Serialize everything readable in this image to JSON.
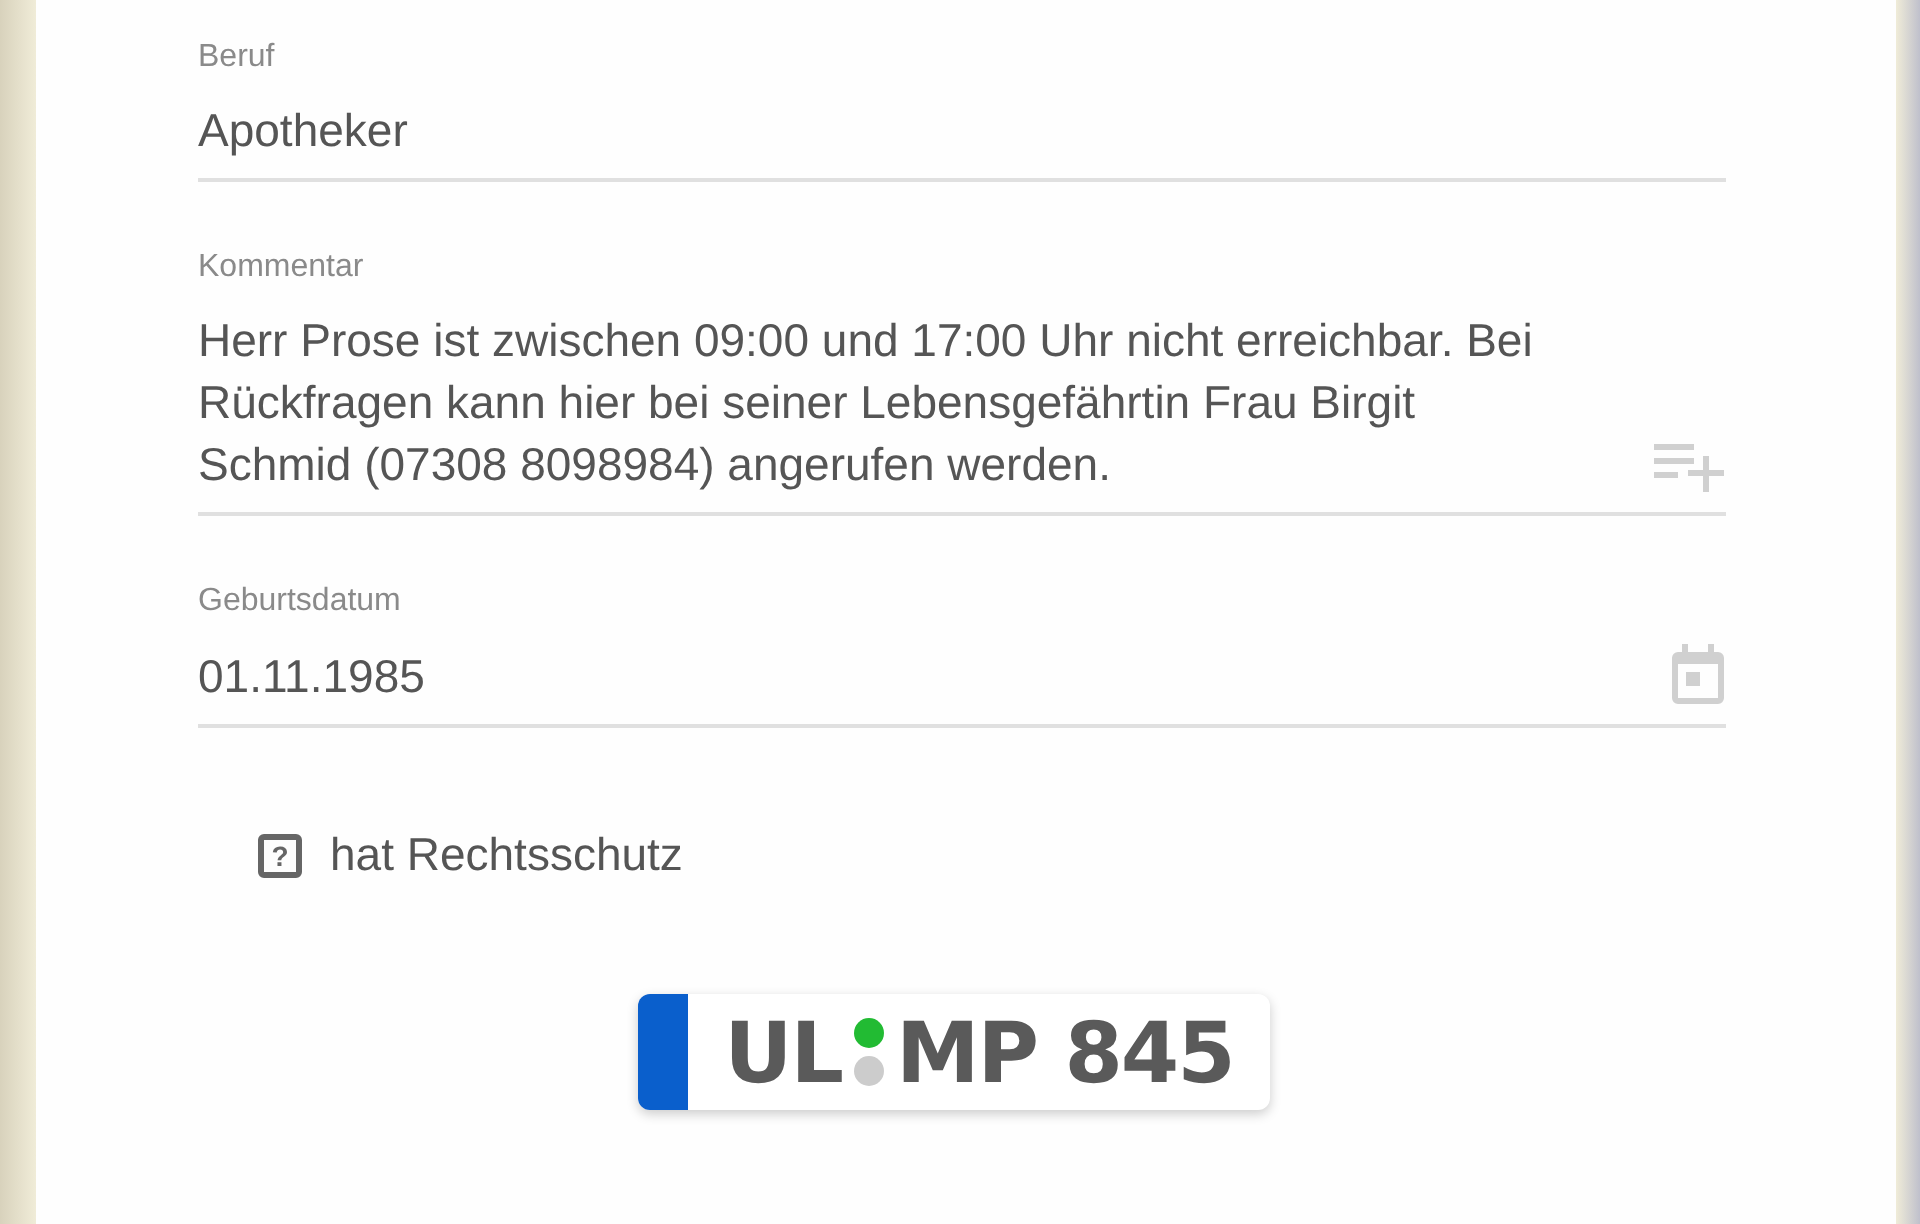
{
  "fields": [
    {
      "kind": "text",
      "label": "Beruf",
      "value": "Apotheker"
    },
    {
      "kind": "multiline",
      "label": "Kommentar",
      "value": "Herr Prose ist zwischen 09:00 und 17:00 Uhr nicht erreichbar. Bei Rückfragen kann hier bei seiner Lebensgefährtin Frau Birgit Schmid (07308 8098984) angerufen werden."
    },
    {
      "kind": "date",
      "label": "Geburtsdatum",
      "value": "01.11.1985"
    }
  ],
  "checkbox": {
    "label": "hat Rechtsschutz",
    "indeterminate": true,
    "symbol": "?"
  },
  "plate": {
    "region": "UL",
    "seals": [
      {
        "color": "#22bb33"
      },
      {
        "color": "#cccccc"
      }
    ],
    "number": "MP 845"
  }
}
